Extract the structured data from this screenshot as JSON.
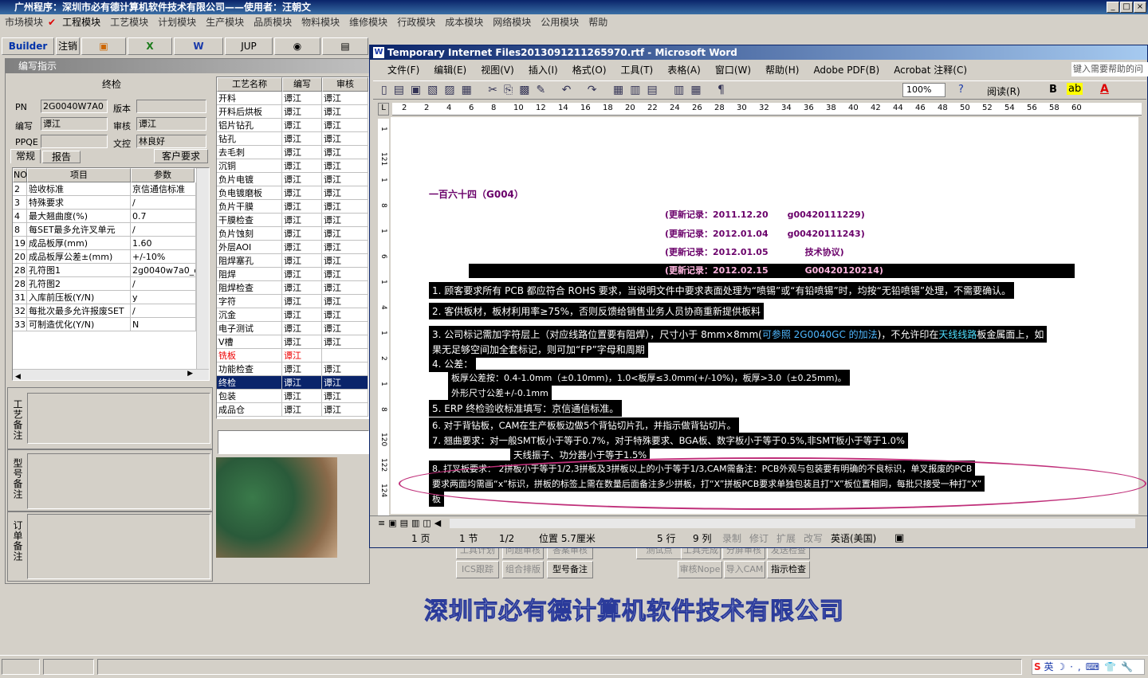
{
  "app": {
    "title": "广州程序：深圳市必有德计算机软件技术有限公司——使用者：汪朝文"
  },
  "menu": [
    "市场模块",
    "工程模块",
    "工艺模块",
    "计划模块",
    "生产模块",
    "品质模块",
    "物料模块",
    "维修模块",
    "行政模块",
    "成本模块",
    "网络模块",
    "公用模块",
    "帮助"
  ],
  "toolbar": {
    "builder": "Builder",
    "logout": "注销",
    "jup": "JUP"
  },
  "panel": {
    "title": "编写指示",
    "section": "终检",
    "pn_label": "PN",
    "pn_value": "2G0040W7A0",
    "version_label": "版本",
    "version_value": "",
    "writer_label": "编写",
    "writer_value": "谭江",
    "reviewer_label": "审核",
    "reviewer_value": "谭江",
    "ppqe_label": "PPQE",
    "ppqe_value": "",
    "doc_label": "文控",
    "doc_value": "林良好",
    "tabs": [
      "常规",
      "报告",
      "客户要求"
    ],
    "params_headers": [
      "NO",
      "项目",
      "参数"
    ],
    "params": [
      [
        "2",
        "验收标准",
        "京信通信标准"
      ],
      [
        "3",
        "特殊要求",
        "/"
      ],
      [
        "4",
        "最大翘曲度(%)",
        "0.7"
      ],
      [
        "8",
        "每SET最多允许叉单元",
        "/"
      ],
      [
        "19",
        "成品板厚(mm)",
        "1.60"
      ],
      [
        "20",
        "成品板厚公差±(mm)",
        "+/-10%"
      ],
      [
        "28",
        "孔符图1",
        "2g0040w7a0_dr"
      ],
      [
        "28",
        "孔符图2",
        "/"
      ],
      [
        "31",
        "入库前压板(Y/N)",
        "y"
      ],
      [
        "32",
        "每批次最多允许报废SET",
        "/"
      ],
      [
        "33",
        "可制造优化(Y/N)",
        "N"
      ]
    ],
    "notes": [
      "工艺备注",
      "型号备注",
      "订单备注"
    ]
  },
  "process": {
    "headers": [
      "工艺名称",
      "编写",
      "审核"
    ],
    "rows": [
      [
        "开料",
        "谭江",
        "谭江"
      ],
      [
        "开料后烘板",
        "谭江",
        "谭江"
      ],
      [
        "铝片钻孔",
        "谭江",
        "谭江"
      ],
      [
        "钻孔",
        "谭江",
        "谭江"
      ],
      [
        "去毛刺",
        "谭江",
        "谭江"
      ],
      [
        "沉铜",
        "谭江",
        "谭江"
      ],
      [
        "负片电镀",
        "谭江",
        "谭江"
      ],
      [
        "负电镀磨板",
        "谭江",
        "谭江"
      ],
      [
        "负片干膜",
        "谭江",
        "谭江"
      ],
      [
        "干膜检查",
        "谭江",
        "谭江"
      ],
      [
        "负片蚀刻",
        "谭江",
        "谭江"
      ],
      [
        "外层AOI",
        "谭江",
        "谭江"
      ],
      [
        "阻焊塞孔",
        "谭江",
        "谭江"
      ],
      [
        "阻焊",
        "谭江",
        "谭江"
      ],
      [
        "阻焊检查",
        "谭江",
        "谭江"
      ],
      [
        "字符",
        "谭江",
        "谭江"
      ],
      [
        "沉金",
        "谭江",
        "谭江"
      ],
      [
        "电子测试",
        "谭江",
        "谭江"
      ],
      [
        "V槽",
        "谭江",
        "谭江"
      ],
      [
        "铣板",
        "谭江",
        ""
      ],
      [
        "功能检查",
        "谭江",
        "谭江"
      ],
      [
        "终检",
        "谭江",
        "谭江"
      ],
      [
        "包装",
        "谭江",
        "谭江"
      ],
      [
        "成品仓",
        "谭江",
        "谭江"
      ]
    ]
  },
  "bottom_buttons": [
    "工具计划",
    "问题审核",
    "答案审核",
    "测试点",
    "工具完成",
    "分屏审核",
    "发送检查",
    "ICS跟踪",
    "组合排版",
    "型号备注",
    "审核Nope",
    "导入CAM",
    "指示检查"
  ],
  "company_banner": "深圳市必有德计算机软件技术有限公司",
  "word": {
    "title": "Temporary Internet Files2013091211265970.rtf - Microsoft Word",
    "menu": [
      "文件(F)",
      "编辑(E)",
      "视图(V)",
      "插入(I)",
      "格式(O)",
      "工具(T)",
      "表格(A)",
      "窗口(W)",
      "帮助(H)",
      "Adobe PDF(B)",
      "Acrobat 注释(C)"
    ],
    "help_box": "键入需要帮助的问",
    "zoom": "100%",
    "read_btn": "阅读(R)",
    "ruler": [
      "2",
      "2",
      "4",
      "6",
      "8",
      "10",
      "12",
      "14",
      "16",
      "18",
      "20",
      "22",
      "24",
      "26",
      "28",
      "30",
      "32",
      "34",
      "36",
      "38",
      "40",
      "42",
      "44",
      "46",
      "48",
      "50",
      "52",
      "54",
      "56",
      "58",
      "60"
    ],
    "vruler": [
      "1",
      "121",
      "1",
      "8",
      "1",
      "6",
      "1",
      "4",
      "1",
      "2",
      "1",
      "8",
      "120",
      "122",
      "124"
    ],
    "doc": {
      "heading": "一百六十四（G004）",
      "updates": [
        [
          "(更新记录：2011.12.20",
          "g00420111229)"
        ],
        [
          "(更新记录：2012.01.04",
          "g00420111243)"
        ],
        [
          "(更新记录：2012.01.05",
          "技术协议)"
        ],
        [
          "(更新记录：2012.02.15",
          "G00420120214)"
        ]
      ],
      "p1": "1. 顾客要求所有 PCB 都应符合 ROHS 要求，当说明文件中要求表面处理为“喷锡”或“有铅喷锡”时，均按“无铅喷锡”处理，不需要确认。",
      "p2": "2.    客供板材，板材利用率≥75%，否则反馈给销售业务人员协商重新提供板料",
      "p3a": "3. 公司标记需加字符层上（对应线路位置要有阻焊），尺寸小于 8mm×8mm(",
      "p3link": "可参照 2G0040GC 的加法",
      "p3b": ")，不允许印在",
      "p3c": "天线线路",
      "p3d": "板金属面上，如",
      "p3e": "果无足够空间加全套标记，则可加“FP”字母和周期",
      "p4": "4.   公差：",
      "p4a": "板厚公差按：0.4-1.0mm（±0.10mm)，1.0<板厚≤3.0mm(+/-10%)，板厚>3.0（±0.25mm)。",
      "p4b": "外形尺寸公差+/-0.1mm",
      "p5": "5.  ERP 终检验收标准填写：京信通信标准。",
      "p6": "6.   对于背钻板，CAM在生产板板边做5个背钻切片孔，并指示做背钻切片。",
      "p7": "7.   翘曲要求：对一般SMT板小于等于0.7%，对于特殊要求、BGA板、数字板小于等于0.5%,非SMT板小于等于1.0%",
      "p7b": "天线振子、功分器小于等于1.5%",
      "p8a": "8.   打叉板要求：  2拼板小于等于1/2,3拼板及3拼板以上的小于等于1/3,CAM需备注：PCB外观与包装要有明确的不良标识，单叉报废的PCB",
      "p8b": "要求两面均需画“x”标识，拼板的标签上需在数量后面备注多少拼板，打“X”拼板PCB要求单独包装且打“X”板位置相同，每批只接受一种打“X”",
      "p8c": "板"
    },
    "status": {
      "page": "1 页",
      "section": "1 节",
      "pages": "1/2",
      "position": "位置 5.7厘米",
      "line": "5 行",
      "col": "9 列",
      "rec": "录制",
      "trk": "修订",
      "ext": "扩展",
      "ovr": "改写",
      "lang": "英语(美国)"
    }
  },
  "taskbar": {
    "ime": "英"
  }
}
